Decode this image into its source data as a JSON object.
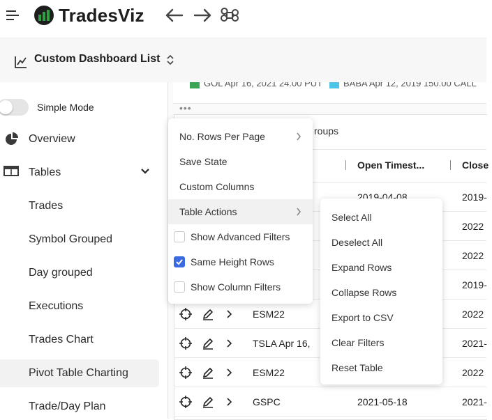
{
  "app": {
    "brand": "TradesViz"
  },
  "dashboard": {
    "title": "Custom Dashboard List"
  },
  "sidebar": {
    "simple_mode_label": "Simple Mode",
    "items": [
      {
        "label": "Overview"
      },
      {
        "label": "Tables"
      },
      {
        "label": "Trades"
      },
      {
        "label": "Symbol Grouped"
      },
      {
        "label": "Day grouped"
      },
      {
        "label": "Executions"
      },
      {
        "label": "Trades Chart"
      },
      {
        "label": "Pivot Table Charting"
      },
      {
        "label": "Trade/Day Plan"
      }
    ]
  },
  "legend": [
    {
      "label": "GOL Apr 16, 2021 24.00 PUT",
      "color": "#3aa655"
    },
    {
      "label": "BABA Apr 12, 2019 150.00 CALL",
      "color": "#4fc3e8"
    }
  ],
  "table": {
    "groups_label": "roups",
    "columns": [
      "Open Timest...",
      "Close"
    ],
    "rows": [
      {
        "symbol": "",
        "open": "2019-04-08",
        "close": "2019-"
      },
      {
        "symbol": "",
        "open": "",
        "close": "2022"
      },
      {
        "symbol": "",
        "open": "",
        "close": "2022"
      },
      {
        "symbol": "",
        "open": "",
        "close": "2019-"
      },
      {
        "symbol": "ESM22",
        "open": "",
        "close": "2022"
      },
      {
        "symbol": "TSLA Apr 16,",
        "open": "",
        "close": "2021-"
      },
      {
        "symbol": "ESM22",
        "open": "",
        "close": "2022"
      },
      {
        "symbol": "GSPC",
        "open": "2021-05-18",
        "close": "2021-"
      }
    ]
  },
  "menu": {
    "items": [
      {
        "label": "No. Rows Per Page"
      },
      {
        "label": "Save State"
      },
      {
        "label": "Custom Columns"
      },
      {
        "label": "Table Actions"
      },
      {
        "label": "Show Advanced Filters",
        "checked": false
      },
      {
        "label": "Same Height Rows",
        "checked": true
      },
      {
        "label": "Show Column Filters",
        "checked": false
      }
    ],
    "submenu": [
      {
        "label": "Select All"
      },
      {
        "label": "Deselect All"
      },
      {
        "label": "Expand Rows"
      },
      {
        "label": "Collapse Rows"
      },
      {
        "label": "Export to CSV"
      },
      {
        "label": "Clear Filters"
      },
      {
        "label": "Reset Table"
      }
    ]
  },
  "colors": {
    "accent": "#3b6be0",
    "logo_green": "#2f9e44"
  }
}
